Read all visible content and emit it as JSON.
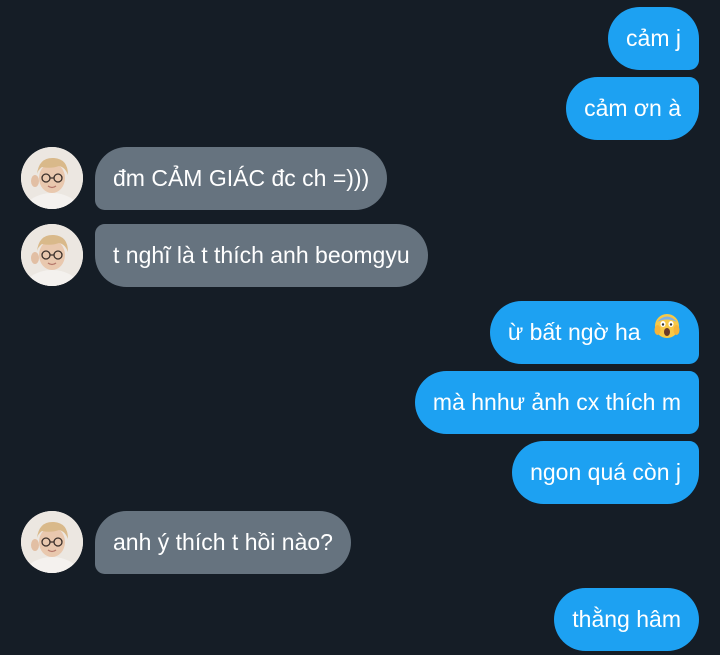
{
  "conversation": {
    "messages": [
      {
        "sender": "me",
        "text": "cảm j"
      },
      {
        "sender": "me",
        "text": "cảm ơn à"
      },
      {
        "sender": "them",
        "text": "đm CẢM GIÁC đc ch =)))"
      },
      {
        "sender": "them",
        "text": "t nghĩ là t thích anh beomgyu"
      },
      {
        "sender": "me",
        "text": "ừ bất ngờ ha",
        "emoji": "face-screaming-in-fear-icon"
      },
      {
        "sender": "me",
        "text": "mà hnhư ảnh cx thích m"
      },
      {
        "sender": "me",
        "text": "ngon quá còn j"
      },
      {
        "sender": "them",
        "text": "anh ý thích t hồi nào?"
      },
      {
        "sender": "me",
        "text": "thằng hâm"
      }
    ]
  },
  "colors": {
    "background": "#151d26",
    "outgoing_bubble": "#1da1f2",
    "incoming_bubble": "#66737f",
    "text": "#ffffff"
  }
}
